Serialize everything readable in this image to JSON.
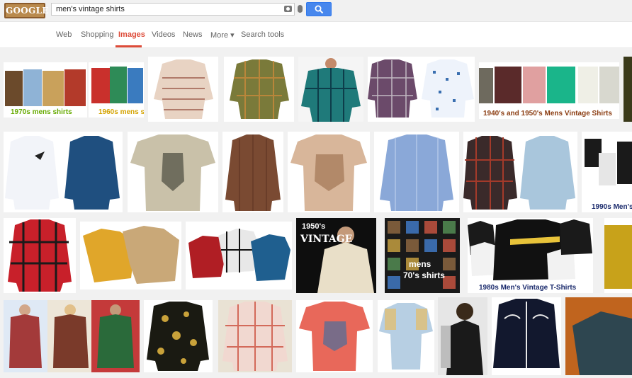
{
  "header": {
    "logo_text": "GOOGLE",
    "search_value": "men's vintage shirts",
    "icons": [
      "camera-icon",
      "mic-icon",
      "search-icon"
    ]
  },
  "tabs": [
    {
      "label": "Web",
      "active": false
    },
    {
      "label": "Shopping",
      "active": false
    },
    {
      "label": "Images",
      "active": true
    },
    {
      "label": "Videos",
      "active": false
    },
    {
      "label": "News",
      "active": false
    },
    {
      "label": "More ▾",
      "active": false
    },
    {
      "label": "Search tools",
      "active": false
    }
  ],
  "captions": {
    "c1a": "1970s mens shirts",
    "c1b": "1960s mens s",
    "c1c": "1940's and 1950's Mens Vintage Shirts",
    "c2a": "1990s Men's",
    "c3a": "1950's",
    "c3b": "VINTAGE",
    "c3c": "mens",
    "c3d": "70's shirts",
    "c3e": "1980s Men's Vintage T-Shirts"
  },
  "colors": {
    "accent": "#dd4b39",
    "search_button": "#4787ed",
    "caption_green": "#66aa00",
    "caption_yellow": "#d4a300",
    "caption_brown": "#8b3d12",
    "caption_navy": "#1a2a6c"
  }
}
